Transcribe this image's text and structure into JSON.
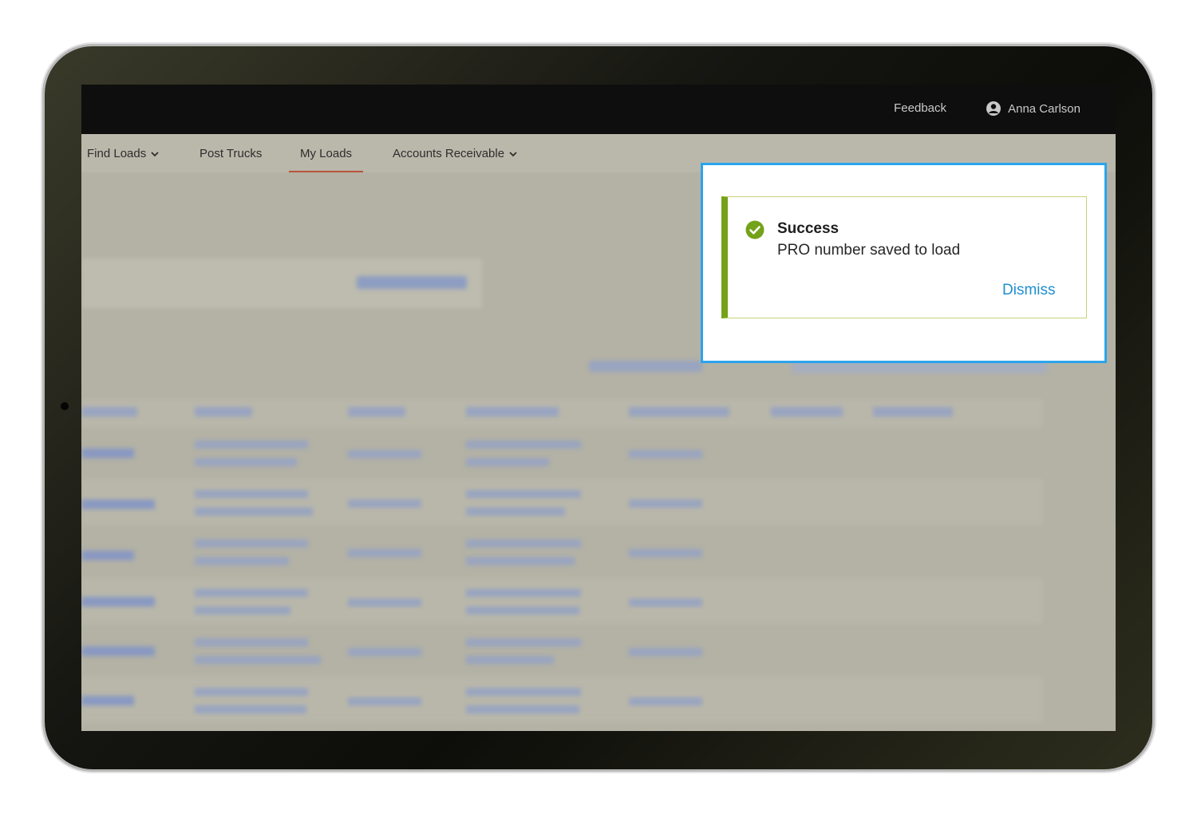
{
  "header": {
    "feedback_label": "Feedback",
    "user_name": "Anna Carlson"
  },
  "nav": {
    "items": [
      {
        "label": "Find Loads",
        "dropdown": true,
        "active": false
      },
      {
        "label": "Post Trucks",
        "dropdown": false,
        "active": false
      },
      {
        "label": "My Loads",
        "dropdown": false,
        "active": true
      },
      {
        "label": "Accounts Receivable",
        "dropdown": true,
        "active": false
      }
    ]
  },
  "notification": {
    "status": "success",
    "title": "Success",
    "message": "PRO number saved to load",
    "dismiss_label": "Dismiss",
    "accent_color": "#74a218",
    "link_color": "#1f8fd0",
    "icon": "check-circle-icon"
  },
  "colors": {
    "topbar": "#0e0e0e",
    "active_tab_underline": "#b7553b",
    "highlight_border": "#2aa4ee"
  }
}
